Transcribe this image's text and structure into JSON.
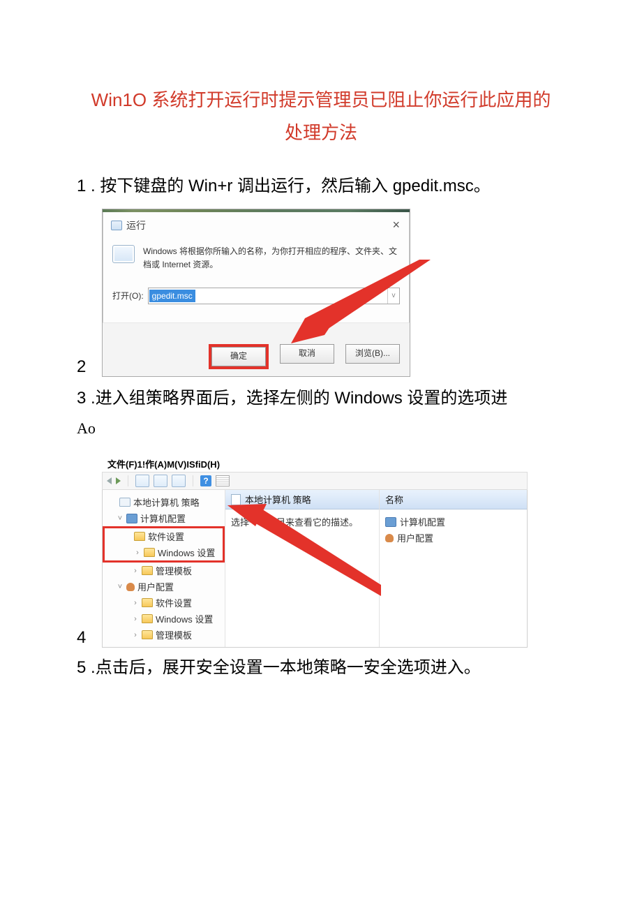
{
  "title": {
    "line1": "Win1O 系统打开运行时提示管理员已阻止你运行此应用的",
    "line2": "处理方法"
  },
  "steps": {
    "s1": {
      "num": "1",
      "text": " . 按下键盘的 Win+r 调出运行，然后输入 gpedit.msc。"
    },
    "s2": {
      "num": "2"
    },
    "s3": {
      "num": "3",
      "text": " .进入组策略界面后，选择左侧的 Windows 设置的选项进",
      "sub": "Ao"
    },
    "s4": {
      "num": "4"
    },
    "s5": {
      "num": "5",
      "text": " .点击后，展开安全设置一本地策略一安全选项进入。"
    }
  },
  "run_dialog": {
    "title": "运行",
    "close": "×",
    "desc": "Windows 将根据你所输入的名称，为你打开相应的程序、文件夹、文档或 Internet 资源。",
    "open_label": "打开(O):",
    "open_value": "gpedit.msc",
    "dropdown": "v",
    "ok": "确定",
    "cancel": "取消",
    "browse": "浏览(B)..."
  },
  "gpedit": {
    "menubar": "文件(F)1!作(A)M(V)ISfiD(H)",
    "toolbar_q": "?",
    "tree": {
      "root": "本地计算机 策略",
      "comp_cfg": "计算机配置",
      "soft1": "软件设置",
      "win1": "Windows 设置",
      "admin1": "管理模板",
      "user_cfg": "用户配置",
      "soft2": "软件设置",
      "win2": "Windows 设置",
      "admin2": "管理模板"
    },
    "mid_title": "本地计算机 策略",
    "mid_text": "选择一个项目来查看它的描述。",
    "right_header": "名称",
    "right_items": {
      "comp": "计算机配置",
      "user": "用户配置"
    }
  }
}
